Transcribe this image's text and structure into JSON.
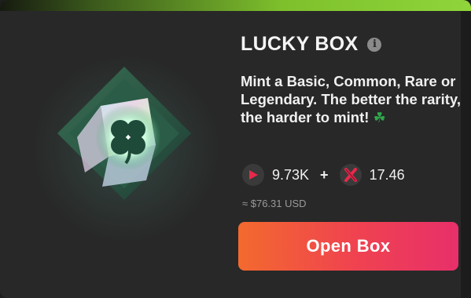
{
  "card": {
    "title": "LUCKY BOX",
    "info_icon_glyph": "i",
    "description": "Mint a Basic, Common, Rare or Legendary. The better the rarity, the harder to mint!",
    "description_emoji": "☘",
    "price": {
      "amount_1": "9.73K",
      "coin_1_icon": "red-play-token-icon",
      "plus": "+",
      "amount_2": "17.46",
      "coin_2_icon": "red-x-token-icon",
      "usd": "≈ $76.31 USD"
    },
    "open_button_label": "Open Box"
  },
  "colors": {
    "accent_green": "#8fd53a",
    "button_start": "#f36a2e",
    "button_end": "#e82f6a",
    "token_red": "#e8294a"
  }
}
